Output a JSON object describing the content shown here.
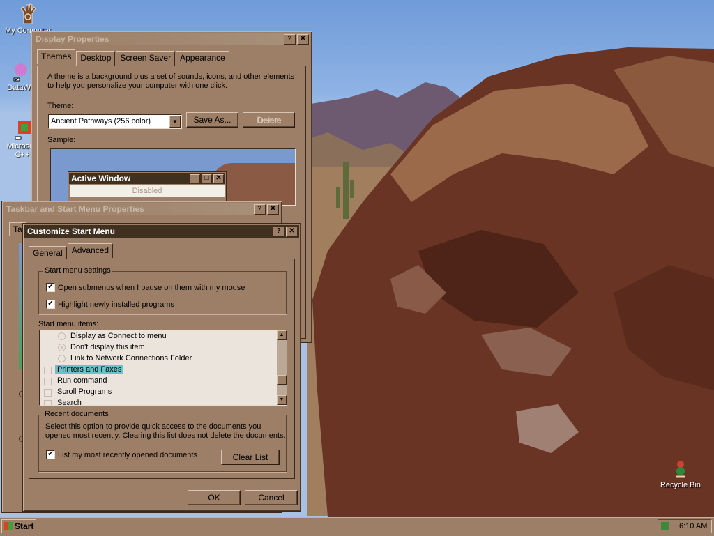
{
  "desktop": {
    "icons": [
      {
        "label": "My Computer",
        "icon": "my-computer-icon"
      },
      {
        "label": "DataWa",
        "icon": "datawa-shortcut-icon"
      },
      {
        "label": "Microsoft",
        "label2": "C++",
        "icon": "visual-cpp-shortcut-icon"
      },
      {
        "label": "Recycle Bin",
        "icon": "recycle-bin-icon"
      }
    ]
  },
  "display_properties": {
    "title": "Display Properties",
    "tabs": [
      "Themes",
      "Desktop",
      "Screen Saver",
      "Appearance"
    ],
    "description_line1": "A theme is a background plus a set of sounds, icons, and other elements",
    "description_line2": "to help you personalize your computer with one click.",
    "theme_label": "Theme:",
    "theme_value": "Ancient Pathways (256 color)",
    "save_as_label": "Save As...",
    "delete_label": "Delete",
    "sample_label": "Sample:",
    "sample_active_window": "Active Window",
    "sample_disabled": "Disabled"
  },
  "taskbar_properties": {
    "title": "Taskbar and Start Menu Properties",
    "tab_stub": "Ta"
  },
  "customize_start_menu": {
    "title": "Customize Start Menu",
    "tabs": [
      "General",
      "Advanced"
    ],
    "settings_group": "Start menu settings",
    "opt_open_submenus": "Open submenus when I pause on them with my mouse",
    "opt_highlight_new": "Highlight newly installed programs",
    "items_label": "Start menu items:",
    "list_items": [
      {
        "label": "Display as Connect to menu",
        "kind": "radio"
      },
      {
        "label": "Don't display this item",
        "kind": "radio"
      },
      {
        "label": "Link to Network Connections Folder",
        "kind": "radio"
      },
      {
        "label": "Printers and Faxes",
        "kind": "check",
        "selected": true
      },
      {
        "label": "Run command",
        "kind": "check"
      },
      {
        "label": "Scroll Programs",
        "kind": "check"
      },
      {
        "label": "Search",
        "kind": "check"
      }
    ],
    "recent_group": "Recent documents",
    "recent_desc1": "Select this option to provide quick access to the documents you",
    "recent_desc2": "opened most recently.  Clearing this list does not delete the documents.",
    "opt_list_recent": "List my most recently opened documents",
    "clear_list_label": "Clear List",
    "ok_label": "OK",
    "cancel_label": "Cancel"
  },
  "taskbar": {
    "start_label": "Start",
    "clock": "6:10 AM"
  },
  "colors": {
    "window_face": "#9c7f66",
    "title_active": "#40301f",
    "selection": "#6bc3c8"
  }
}
